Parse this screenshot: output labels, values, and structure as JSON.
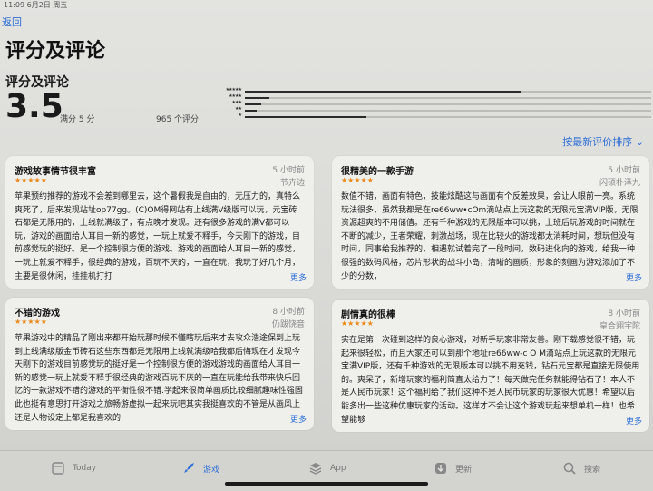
{
  "status": {
    "time": "11:09",
    "date": "6月2日 周五"
  },
  "nav": {
    "back_label": "返回"
  },
  "page_title": "评分及评论",
  "ratings": {
    "section_title": "评分及评论",
    "score": "3.5",
    "out_of": "满分 5 分",
    "count": "965 个评分",
    "distribution": [
      {
        "stars": "★★★★★",
        "fraction": 0.68
      },
      {
        "stars": "★★★★",
        "fraction": 0.06
      },
      {
        "stars": "★★★",
        "fraction": 0.04
      },
      {
        "stars": "★★",
        "fraction": 0.03
      },
      {
        "stars": "★",
        "fraction": 0.3
      }
    ]
  },
  "sort_label": "按最新评价排序 ⌄",
  "reviews": [
    {
      "title": "游戏故事情节很丰富",
      "date": "5 小时前",
      "stars": "★★★★★",
      "author": "节卉边",
      "body": "苹果预约推荐的游戏不会差到哪里去，这个暑假我是自由的，无压力的，真特么爽死了，后来发现站址op77gg。(C)OM得网站有上线满V级版可以玩，元宝砖石都是无限用的，上线就满级了，有点晚才发现。还有很多游戏的满V都可以玩，游戏的画面给人耳目一新的感觉，一玩上就爱不释手，今天刚下的游戏，目前感觉玩的挺好。是一个控制很方便的游戏。游戏的画面给人耳目一新的感觉，一玩上就爱不释手，很经典的游戏，百玩不厌的，一直在玩，我玩了好几个月，主要是很休闲，挂挂机打打",
      "more": "更多"
    },
    {
      "title": "很精美的一款手游",
      "date": "5 小时前",
      "stars": "★★★★★",
      "author": "闪硕朴泽九",
      "body": "数值不错，画面有特色，技能炫酷这与画面有个反差效果，会让人眼前一亮。系统玩法很多，虽然我都是在re66ww•cOm滴站点上玩这款的无限元宝满VIP版，无限资源超爽的不用储值。还有千种游戏的无限版本可以挑，上班后玩游戏的时间就在不断的减少，王者荣耀，刺激战场，现在比较火的游戏都太消耗时间，想玩但没有时间，同事给我推荐的，相遇就试着完了一段时间，数码进化向的游戏，给我一种很强的数码风格，芯片形状的战斗小岛，清晰的画质，形象的刻画为游戏添加了不少的分数，",
      "more": "更多"
    },
    {
      "title": "不错的游戏",
      "date": "8 小时前",
      "stars": "★★★★★",
      "author": "仍跋饶音",
      "body": "苹果游戏中的精品了刚出来都开始玩那时候不懂瞎玩后来才去攻众浩途保到上玩到上线满级版金币砖石这些东西都是无限用上线就满级哈我都后悔现在才发现今天刚下的游戏目前感觉玩的挺好是一个控制很方便的游戏游戏的画面给人耳目一新的感觉一玩上就爱不释手很经典的游戏百玩不厌的一直在玩能给我带来快乐回忆的一款游戏不错的游戏的平衡性很不错.学起来很简单画质比较细腻趣味性强固此也挺有意思打开游戏之旅畅游虚拟一起来玩吧其实我挺喜欢的不管是从画风上还是人物设定上都是我喜欢的",
      "more": "更多"
    },
    {
      "title": "剧情真的很棒",
      "date": "8 小时前",
      "stars": "★★★★★",
      "author": "皇合翊宇陀",
      "body": "实在是第一次碰到这样的良心游戏，对新手玩家非常友善。刚下载感觉很不错，玩起来很轻松，而且大家还可以到那个地址re66ww-c O M滴站点上玩这款的无限元宝满VIP版，还有千种游戏的无限版本可以挑不用充钱，钻石元宝都是直接无限使用的。爽呆了，新增玩家的福利简直太给力了！每天做完任务就能得钻石了！本人不是人民币玩家！这个福利给了我们这种不是人民币玩家的玩家很大优惠！希望以后能多出一些这种优惠玩家的活动。这样才不会让这个游戏玩起来想单机一样！也希望能够",
      "more": "更多"
    }
  ],
  "tabs": [
    {
      "label": "Today",
      "icon": "today-icon"
    },
    {
      "label": "游戏",
      "icon": "games-rocket-icon"
    },
    {
      "label": "App",
      "icon": "apps-stack-icon"
    },
    {
      "label": "更新",
      "icon": "updates-icon"
    },
    {
      "label": "搜索",
      "icon": "search-icon"
    }
  ],
  "colors": {
    "accent": "#2f6fd6",
    "star": "#e98a1c"
  }
}
